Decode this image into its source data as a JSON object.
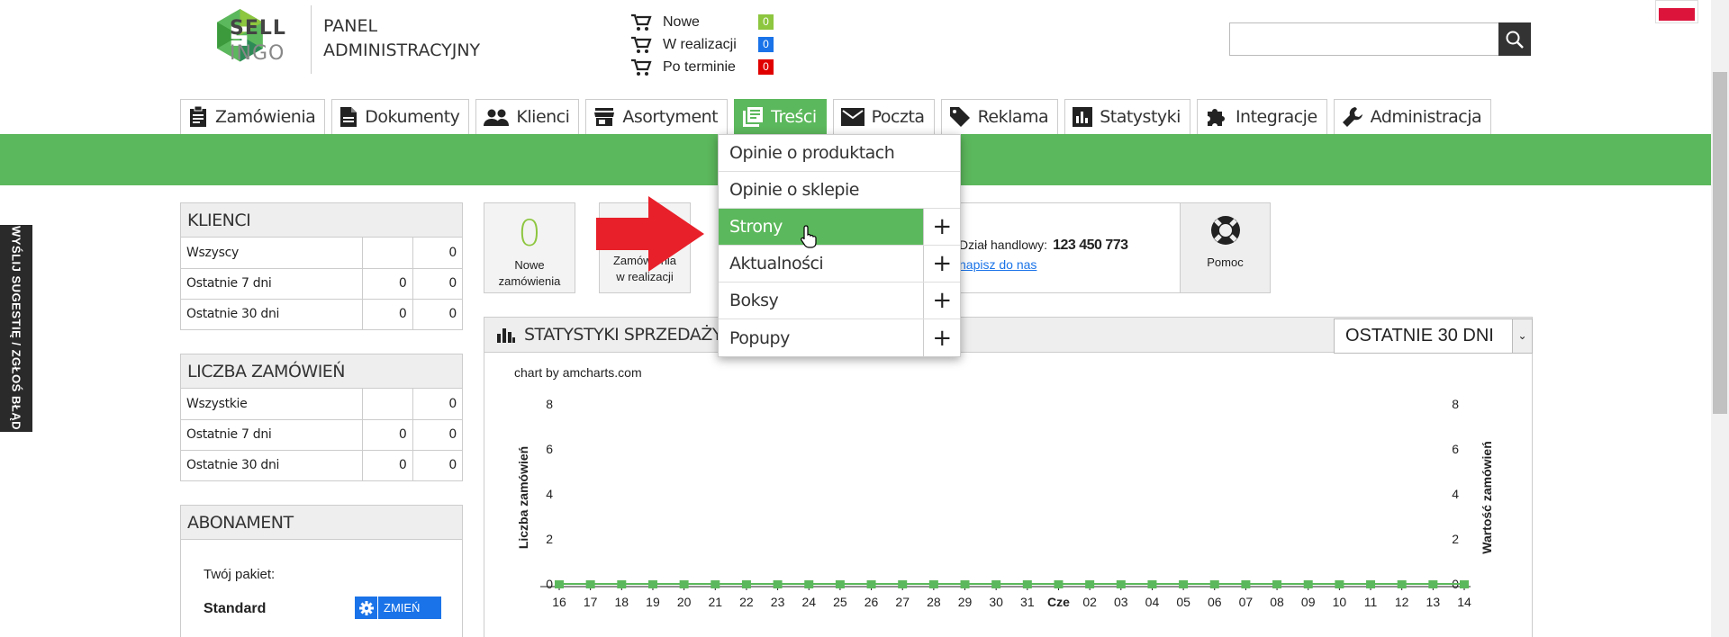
{
  "brand": {
    "logo_top": "SELL",
    "logo_bottom": "INGO",
    "panel_line1": "PANEL",
    "panel_line2": "ADMINISTRACYJNY"
  },
  "orders": [
    {
      "label": "Nowe",
      "count": "0",
      "color": "#8dc63f"
    },
    {
      "label": "W realizacji",
      "count": "0",
      "color": "#1a73e8"
    },
    {
      "label": "Po terminie",
      "count": "0",
      "color": "#e00000"
    }
  ],
  "search": {
    "placeholder": "",
    "value": ""
  },
  "nav": [
    {
      "label": "Zamówienia",
      "icon": "clipboard-icon"
    },
    {
      "label": "Dokumenty",
      "icon": "document-icon"
    },
    {
      "label": "Klienci",
      "icon": "people-icon"
    },
    {
      "label": "Asortyment",
      "icon": "store-icon"
    },
    {
      "label": "Treści",
      "icon": "content-icon",
      "active": true
    },
    {
      "label": "Poczta",
      "icon": "mail-icon"
    },
    {
      "label": "Reklama",
      "icon": "tag-icon"
    },
    {
      "label": "Statystyki",
      "icon": "chart-icon"
    },
    {
      "label": "Integracje",
      "icon": "puzzle-icon"
    },
    {
      "label": "Administracja",
      "icon": "wrench-icon"
    }
  ],
  "dropdown": [
    {
      "label": "Opinie o produktach",
      "plus": false
    },
    {
      "label": "Opinie o sklepie",
      "plus": false
    },
    {
      "label": "Strony",
      "plus": true,
      "active": true
    },
    {
      "label": "Aktualności",
      "plus": true
    },
    {
      "label": "Boksy",
      "plus": true
    },
    {
      "label": "Popupy",
      "plus": true
    }
  ],
  "suggest": "WYŚLIJ SUGESTIĘ / ZGŁOŚ BŁĄD",
  "klienci": {
    "title": "KLIENCI",
    "rows": [
      {
        "label": "Wszyscy",
        "a": "",
        "b": "0"
      },
      {
        "label": "Ostatnie 7 dni",
        "a": "0",
        "b": "0"
      },
      {
        "label": "Ostatnie 30 dni",
        "a": "0",
        "b": "0"
      }
    ]
  },
  "zamowienia": {
    "title": "LICZBA ZAMÓWIEŃ",
    "rows": [
      {
        "label": "Wszystkie",
        "a": "",
        "b": "0"
      },
      {
        "label": "Ostatnie 7 dni",
        "a": "0",
        "b": "0"
      },
      {
        "label": "Ostatnie 30 dni",
        "a": "0",
        "b": "0"
      }
    ]
  },
  "abonament": {
    "title": "ABONAMENT",
    "pakiet_label": "Twój pakiet:",
    "pakiet": "Standard",
    "button": "ZMIEŃ"
  },
  "tiles": {
    "nowe": {
      "value": "0",
      "line1": "Nowe",
      "line2": "zamówienia"
    },
    "realizacja": {
      "line1": "Zamówienia",
      "line2": "w realizacji"
    }
  },
  "contact": {
    "label": "Dział handlowy:",
    "phone": "123 450 773",
    "link": "napisz do nas"
  },
  "pomoc": {
    "label": "Pomoc"
  },
  "stats": {
    "title": "STATYSTYKI SPRZEDAŻY",
    "period": "OSTATNIE 30 DNI"
  },
  "chart_data": {
    "type": "line",
    "credit": "chart by amcharts.com",
    "ylabel": "Liczba zamówień",
    "y2label": "Wartość zamówień",
    "ylim": [
      0,
      8
    ],
    "yticks": [
      0,
      2,
      4,
      6,
      8
    ],
    "categories": [
      "16",
      "17",
      "18",
      "19",
      "20",
      "21",
      "22",
      "23",
      "24",
      "25",
      "26",
      "27",
      "28",
      "29",
      "30",
      "31",
      "Cze",
      "02",
      "03",
      "04",
      "05",
      "06",
      "07",
      "08",
      "09",
      "10",
      "11",
      "12",
      "13",
      "14"
    ],
    "series": [
      {
        "values": [
          0,
          0,
          0,
          0,
          0,
          0,
          0,
          0,
          0,
          0,
          0,
          0,
          0,
          0,
          0,
          0,
          0,
          0,
          0,
          0,
          0,
          0,
          0,
          0,
          0,
          0,
          0,
          0,
          0,
          0
        ],
        "color": "#5cb85c"
      }
    ]
  }
}
